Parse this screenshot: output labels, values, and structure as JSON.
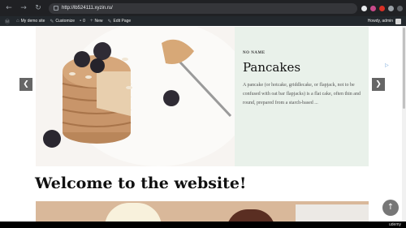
{
  "browser": {
    "url": "http://lb524111.xyzin.ru/",
    "back_icon": "back-arrow-icon",
    "forward_icon": "forward-arrow-icon",
    "reload_icon": "reload-icon"
  },
  "admin_bar": {
    "site_name": "My demo site",
    "customize": "Customize",
    "comments_count": "0",
    "new": "New",
    "edit_page": "Edit Page",
    "greeting": "Howdy, admin"
  },
  "slider": {
    "tag": "NO NAME",
    "title": "Pancakes",
    "text": "A pancake (or hotcake, griddlecake, or flapjack, not to be confused with oat bar flapjacks) is a flat cake, often thin and round, prepared from a starch-based ...",
    "prev_glyph": "❮",
    "next_glyph": "❯"
  },
  "page": {
    "heading": "Welcome to the website!"
  },
  "misc": {
    "to_top_glyph": "↑",
    "brand": "udemy"
  },
  "colors": {
    "panel_bg": "#e9f1ea",
    "admin_bar_bg": "#23282d",
    "browser_bar_bg": "#202124"
  }
}
